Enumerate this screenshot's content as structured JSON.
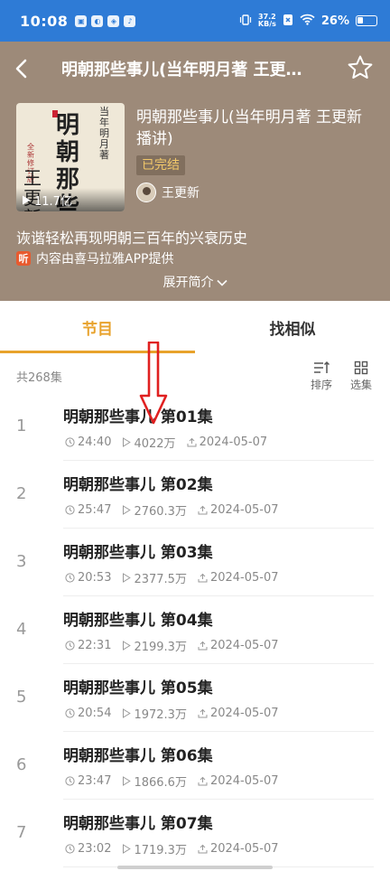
{
  "status_bar": {
    "time": "10:08",
    "net_speed_top": "37.2",
    "net_speed_bottom": "KB/s",
    "battery": "26%"
  },
  "header": {
    "title": "明朝那些事儿(当年明月著 王更…",
    "album_title": "明朝那些事儿(当年明月著 王更新播讲)",
    "play_count": "11.7亿",
    "status_tag": "已完结",
    "author": "王更新",
    "intro": "诙谐轻松再现明朝三百年的兴衰历史",
    "provider_logo": "听",
    "provider": "内容由喜马拉雅APP提供",
    "expand": "展开简介",
    "cover": {
      "main_text": "明朝那些事儿",
      "author_text": "当年明月著",
      "series_text": "全新修订版",
      "reader_text": "王更新"
    }
  },
  "tabs": [
    {
      "label": "节目",
      "active": true
    },
    {
      "label": "找相似",
      "active": false
    }
  ],
  "list_header": {
    "count": "共268集",
    "sort_label": "排序",
    "select_label": "选集"
  },
  "episodes": [
    {
      "index": "1",
      "title": "明朝那些事儿 第01集",
      "duration": "24:40",
      "plays": "4022万",
      "date": "2024-05-07"
    },
    {
      "index": "2",
      "title": "明朝那些事儿 第02集",
      "duration": "25:47",
      "plays": "2760.3万",
      "date": "2024-05-07"
    },
    {
      "index": "3",
      "title": "明朝那些事儿 第03集",
      "duration": "20:53",
      "plays": "2377.5万",
      "date": "2024-05-07"
    },
    {
      "index": "4",
      "title": "明朝那些事儿 第04集",
      "duration": "22:31",
      "plays": "2199.3万",
      "date": "2024-05-07"
    },
    {
      "index": "5",
      "title": "明朝那些事儿 第05集",
      "duration": "20:54",
      "plays": "1972.3万",
      "date": "2024-05-07"
    },
    {
      "index": "6",
      "title": "明朝那些事儿 第06集",
      "duration": "23:47",
      "plays": "1866.6万",
      "date": "2024-05-07"
    },
    {
      "index": "7",
      "title": "明朝那些事儿 第07集",
      "duration": "23:02",
      "plays": "1719.3万",
      "date": "2024-05-07"
    }
  ],
  "colors": {
    "status_bar": "#2e7bd6",
    "header_bg": "#9d8a79",
    "accent": "#e8a22c",
    "annotation_arrow": "#e02020"
  },
  "icons": {
    "back": "chevron-left-icon",
    "favorite": "star-outline-icon",
    "duration": "clock-icon",
    "plays": "play-triangle-icon",
    "date": "upload-icon",
    "sort": "sort-icon",
    "select": "grid-icon"
  }
}
